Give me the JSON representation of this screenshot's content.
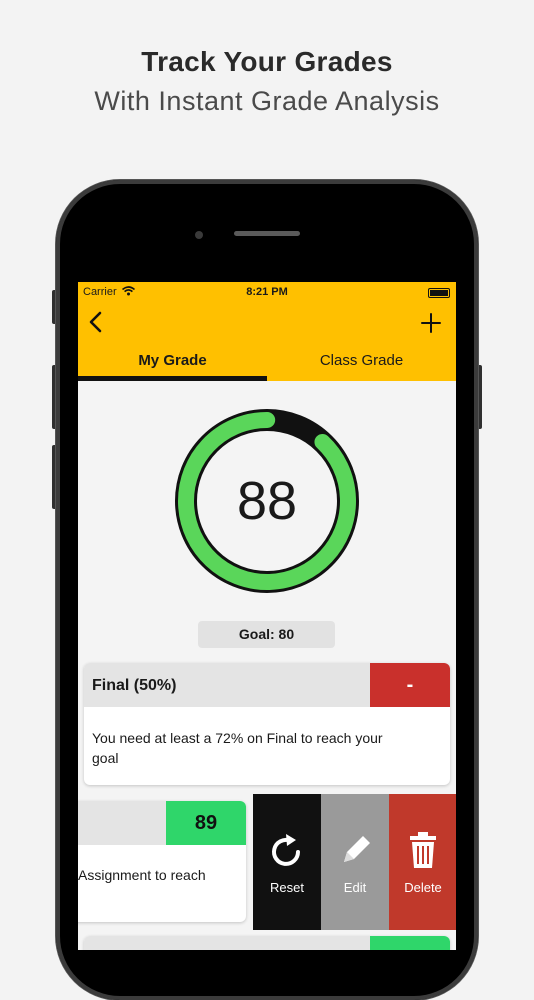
{
  "promo": {
    "headline": "Track Your Grades",
    "subheadline": "With Instant Grade Analysis"
  },
  "status_bar": {
    "carrier": "Carrier",
    "time": "8:21 PM"
  },
  "nav": {
    "back_icon": "chevron-left-icon",
    "add_icon": "plus-icon"
  },
  "tabs": [
    {
      "label": "My Grade",
      "selected": true
    },
    {
      "label": "Class Grade",
      "selected": false
    }
  ],
  "grade": {
    "value": "88",
    "progress": 0.88,
    "ring_color": "#5ad65a"
  },
  "goal": {
    "label": "Goal: 80"
  },
  "cards": [
    {
      "title": "Final (50%)",
      "score": "-",
      "score_color": "#c9302c",
      "message": "You need at least a 72% on Final to reach your goal"
    },
    {
      "title": "",
      "score": "89",
      "score_color": "#2fd66a",
      "message": "Assignment to reach"
    }
  ],
  "swipe_actions": [
    {
      "label": "Reset",
      "icon": "reset-icon",
      "color": "#111111"
    },
    {
      "label": "Edit",
      "icon": "pencil-icon",
      "color": "#9a9a9a"
    },
    {
      "label": "Delete",
      "icon": "trash-icon",
      "color": "#c0392b"
    }
  ],
  "colors": {
    "accent": "#ffc000",
    "background": "#f4f4f4"
  }
}
